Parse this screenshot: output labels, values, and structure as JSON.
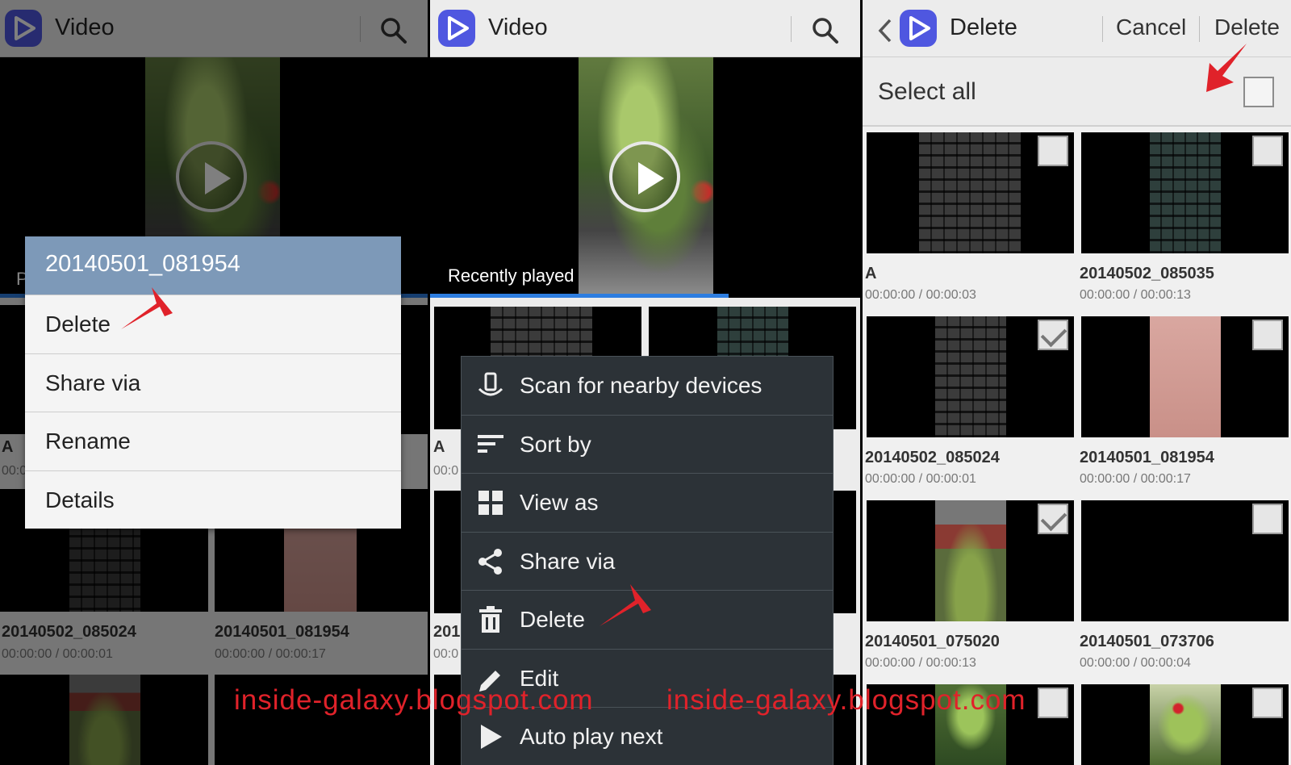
{
  "panel1": {
    "app_title": "Video",
    "context_menu": {
      "title": "20140501_081954",
      "items": [
        "Delete",
        "Share via",
        "Rename",
        "Details"
      ]
    },
    "tiles": [
      {
        "title": "A",
        "time": "00:0"
      },
      {
        "title": "20140502_085024",
        "time": "00:00:00 / 00:00:01"
      },
      {
        "title": "20140501_081954",
        "time": "00:00:00 / 00:00:17"
      }
    ],
    "partial_label": "P"
  },
  "panel2": {
    "app_title": "Video",
    "hero_caption": "Recently played",
    "partial_tiles": [
      {
        "title": "A",
        "time": "00:0"
      },
      {
        "title": "201",
        "time": "00:0"
      }
    ],
    "overflow_menu": [
      {
        "label": "Scan for nearby devices",
        "icon": "scan-devices-icon"
      },
      {
        "label": "Sort by",
        "icon": "sort-icon"
      },
      {
        "label": "View as",
        "icon": "grid-view-icon"
      },
      {
        "label": "Share via",
        "icon": "share-icon"
      },
      {
        "label": "Delete",
        "icon": "trash-icon"
      },
      {
        "label": "Edit",
        "icon": "edit-icon"
      },
      {
        "label": "Auto play next",
        "icon": "play-icon"
      }
    ]
  },
  "panel3": {
    "title": "Delete",
    "cancel_label": "Cancel",
    "delete_label": "Delete",
    "select_all_label": "Select all",
    "items": [
      {
        "title": "A",
        "time": "00:00:00 / 00:00:03",
        "checked": false
      },
      {
        "title": "20140502_085035",
        "time": "00:00:00 / 00:00:13",
        "checked": false
      },
      {
        "title": "20140502_085024",
        "time": "00:00:00 / 00:00:01",
        "checked": true
      },
      {
        "title": "20140501_081954",
        "time": "00:00:00 / 00:00:17",
        "checked": false
      },
      {
        "title": "20140501_075020",
        "time": "00:00:00 / 00:00:13",
        "checked": true
      },
      {
        "title": "20140501_073706",
        "time": "00:00:00 / 00:00:04",
        "checked": false
      }
    ]
  },
  "watermark": "inside-galaxy.blogspot.com",
  "colors": {
    "accent_blue": "#2d7de0",
    "app_icon": "#4f57e0",
    "arrow_red": "#e0222a",
    "menu_header": "#7d99b8",
    "dark_menu": "#2c3237"
  }
}
